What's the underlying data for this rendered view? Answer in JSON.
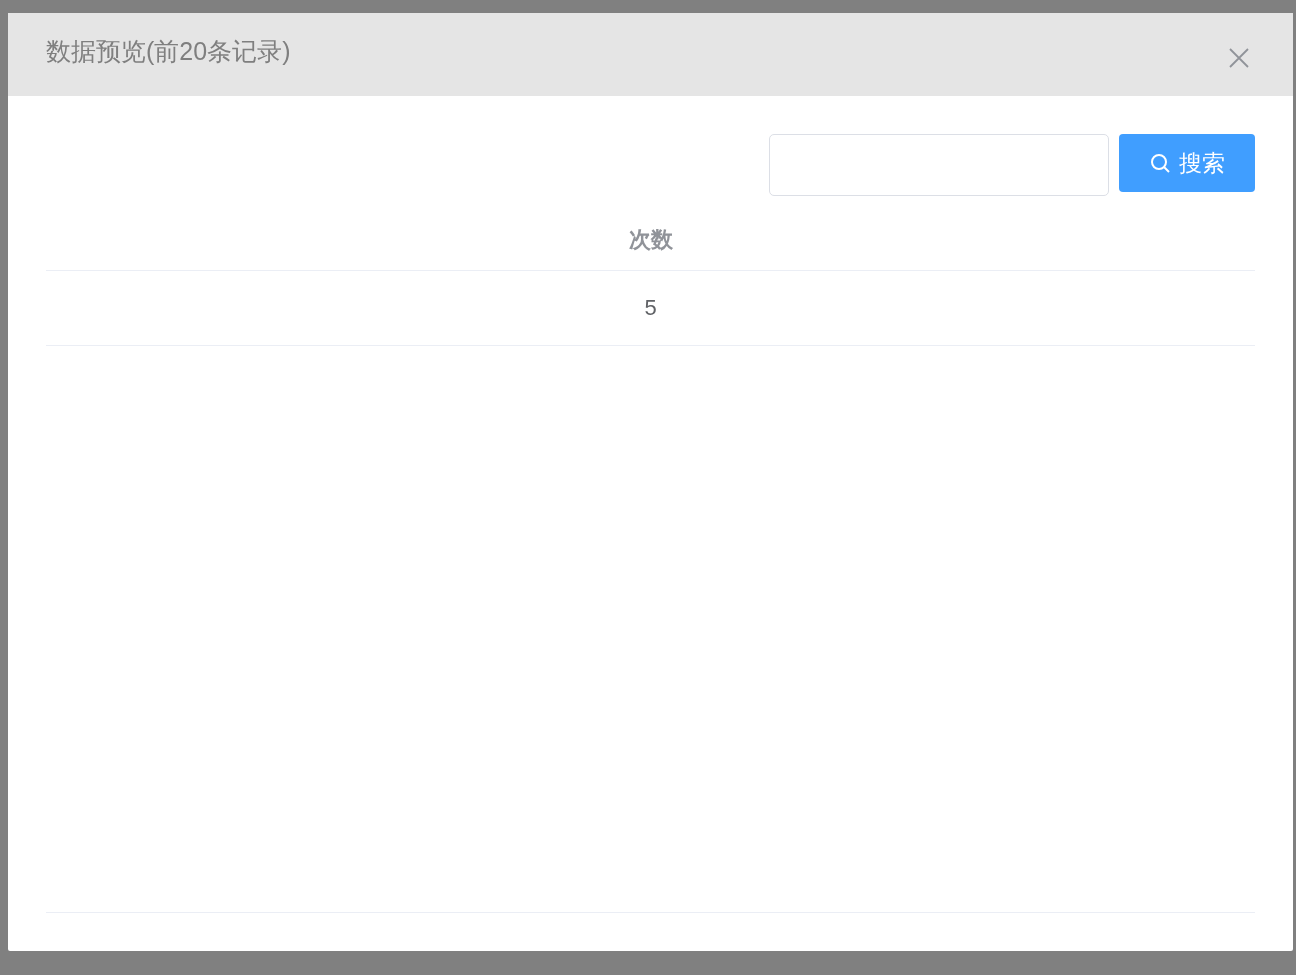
{
  "dialog": {
    "title": "数据预览(前20条记录)"
  },
  "search": {
    "button": "搜索"
  },
  "table": {
    "columns": [
      "次数"
    ],
    "rows": [
      [
        "5"
      ]
    ]
  }
}
